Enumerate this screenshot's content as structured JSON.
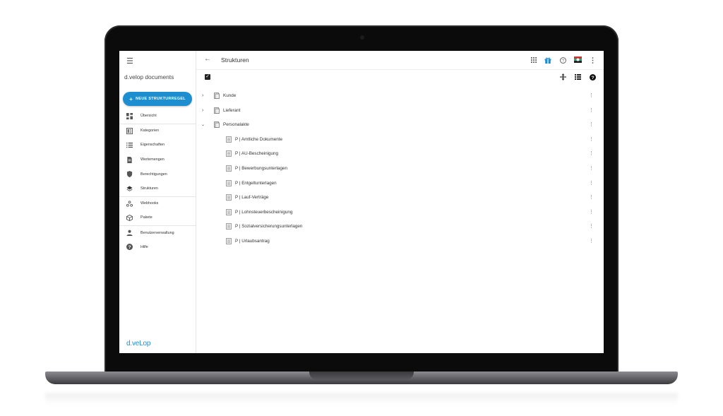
{
  "app": {
    "title": "d.velop documents",
    "brand": "d.veLop",
    "new_button": "NEUE STRUKTURREGEL"
  },
  "nav": [
    {
      "label": "Übersicht",
      "icon": "dashboard-icon"
    },
    {
      "label": "Kategorien",
      "icon": "category-icon"
    },
    {
      "label": "Eigenschaften",
      "icon": "list-icon"
    },
    {
      "label": "Wertemengen",
      "icon": "document-icon"
    },
    {
      "label": "Berechtigungen",
      "icon": "shield-icon"
    },
    {
      "label": "Strukturen",
      "icon": "layers-icon"
    },
    {
      "label": "Webhooks",
      "icon": "webhook-icon"
    },
    {
      "label": "Pakete",
      "icon": "package-icon"
    },
    {
      "label": "Benutzerverwaltung",
      "icon": "person-icon"
    },
    {
      "label": "Hilfe",
      "icon": "help-icon"
    }
  ],
  "page": {
    "title": "Strukturen"
  },
  "tree": {
    "roots": [
      {
        "label": "Kunde",
        "expanded": false
      },
      {
        "label": "Lieferant",
        "expanded": false
      },
      {
        "label": "Personalakte",
        "expanded": true
      }
    ],
    "children": [
      "P | Amtliche Dokumente",
      "P | AU-Bescheinigung",
      "P | Bewerbungsunterlagen",
      "P | Entgeltunterlagen",
      "P | Lauf-Verträge",
      "P | Lohnsteuerbescheinigung",
      "P | Sozialversicherungsunterlagen",
      "P | Urlaubsantrag"
    ]
  },
  "colors": {
    "accent": "#1d8fd1",
    "text": "#333333",
    "bezel": "#0b0b0c"
  }
}
